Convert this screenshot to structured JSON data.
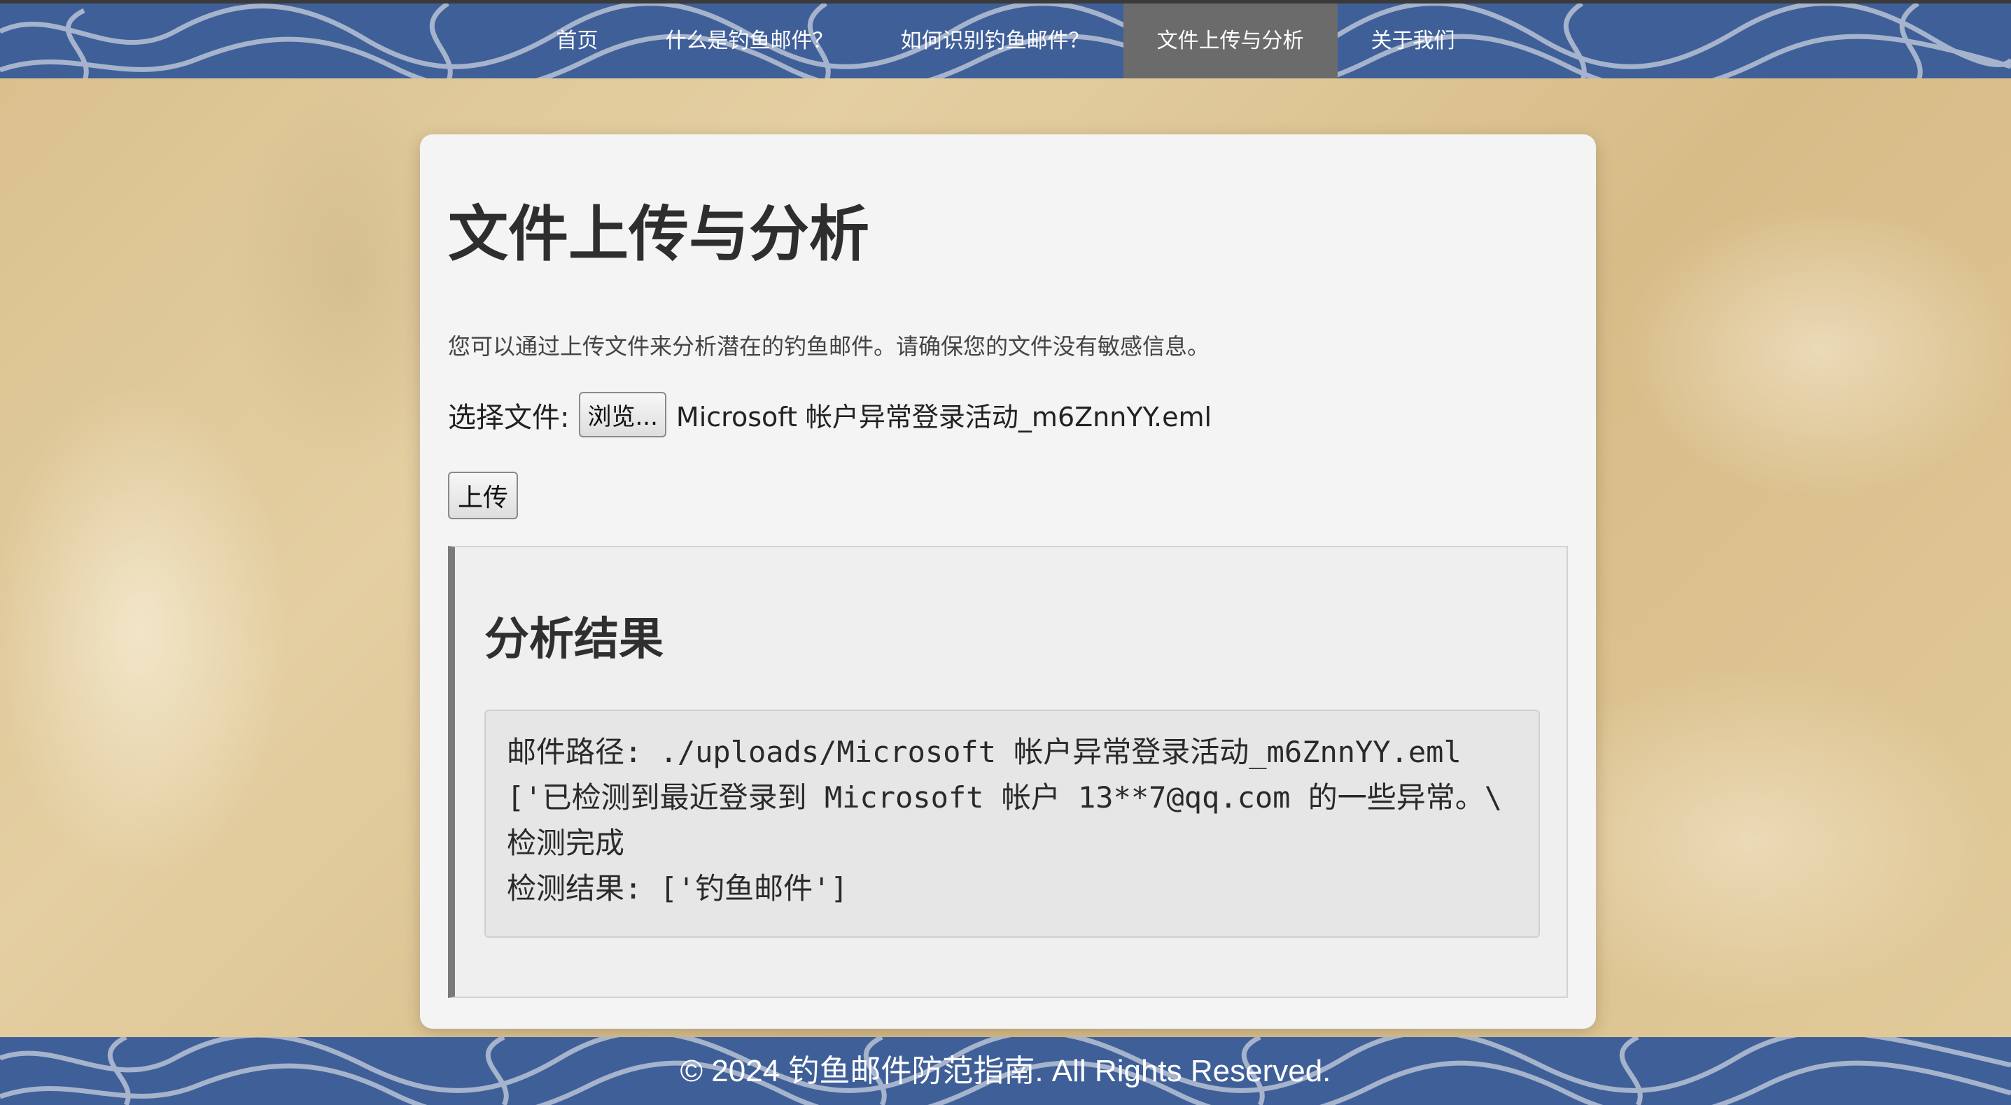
{
  "nav": {
    "items": [
      {
        "label": "首页"
      },
      {
        "label": "什么是钓鱼邮件？"
      },
      {
        "label": "如何识别钓鱼邮件？"
      },
      {
        "label": "文件上传与分析"
      },
      {
        "label": "关于我们"
      }
    ],
    "active_index": 3
  },
  "main": {
    "title": "文件上传与分析",
    "description": "您可以通过上传文件来分析潜在的钓鱼邮件。请确保您的文件没有敏感信息。",
    "file_label": "选择文件:",
    "browse_label": "浏览...",
    "selected_file": "Microsoft 帐户异常登录活动_m6ZnnYY.eml",
    "upload_label": "上传"
  },
  "result": {
    "heading": "分析结果",
    "lines": [
      "邮件路径:  ./uploads/Microsoft 帐户异常登录活动_m6ZnnYY.eml",
      "['已检测到最近登录到 Microsoft 帐户 13**7@qq.com 的一些异常。\\",
      "检测完成",
      "检测结果: ['钓鱼邮件']"
    ]
  },
  "footer": {
    "text": "© 2024 钓鱼邮件防范指南. All Rights Reserved."
  },
  "colors": {
    "band": "#3f5f98",
    "active_nav": "#6b6b6b",
    "card": "#f4f4f4",
    "result_border": "#7a7a7a"
  }
}
